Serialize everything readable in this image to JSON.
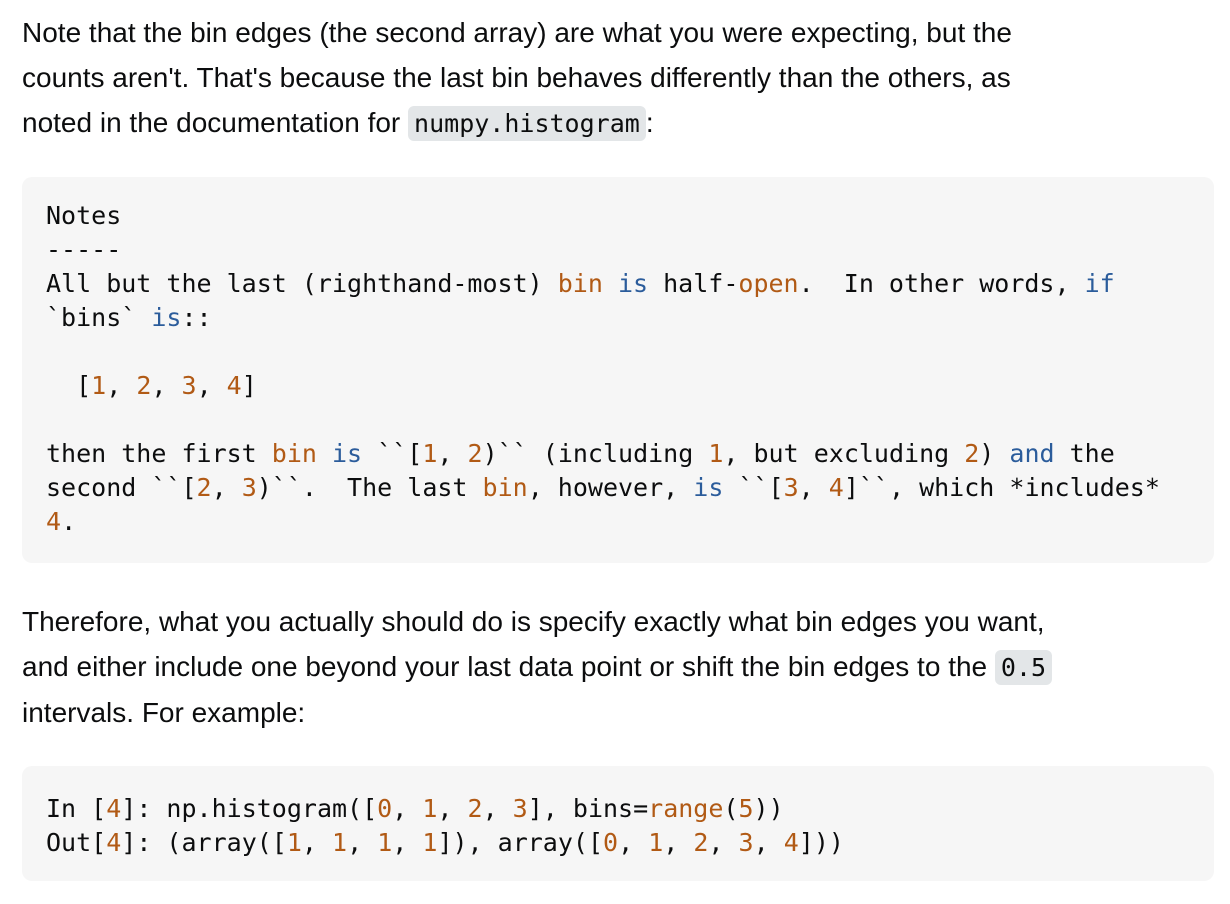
{
  "para1": {
    "line1": "Note that the bin edges (the second array) are what you were expecting, but the",
    "line2": "counts aren't. That's because the last bin behaves differently than the others, as",
    "line3_prefix": "noted in the documentation for ",
    "line3_code": "numpy.histogram",
    "line3_suffix": ":"
  },
  "notes_block": {
    "l1": "Notes",
    "l2": "-----",
    "l3": {
      "a": "All but the last (righthand-most) ",
      "b": "bin",
      "c": " ",
      "d": "is",
      "e": " half-",
      "f": "open",
      "g": ".  In other words, ",
      "h": "if"
    },
    "l4": {
      "a": "`bins` ",
      "b": "is",
      "c": "::"
    },
    "l5": "",
    "l6": {
      "a": "  [",
      "n1": "1",
      "s1": ", ",
      "n2": "2",
      "s2": ", ",
      "n3": "3",
      "s3": ", ",
      "n4": "4",
      "e": "]"
    },
    "l7": "",
    "l8": {
      "a": "then the first ",
      "b": "bin",
      "c": " ",
      "d": "is",
      "e": " ``[",
      "n1": "1",
      "s1": ", ",
      "n2": "2",
      "f": ")`` (including ",
      "n3": "1",
      "g": ", but excluding ",
      "n4": "2",
      "h": ") ",
      "i": "and",
      "j": " the"
    },
    "l9": {
      "a": "second ``[",
      "n1": "2",
      "s1": ", ",
      "n2": "3",
      "b": ")``.  The last ",
      "c": "bin",
      "d": ", however, ",
      "e": "is",
      "f": " ``[",
      "n3": "3",
      "s2": ", ",
      "n4": "4",
      "g": "]``, which *includes*"
    },
    "l10": {
      "n1": "4",
      "a": "."
    }
  },
  "para2": {
    "line1": "Therefore, what you actually should do is specify exactly what bin edges you want,",
    "line2_prefix": "and either include one beyond your last data point or shift the bin edges to the ",
    "line2_code": "0.5",
    "line3": "intervals. For example:"
  },
  "example_block": {
    "l1": {
      "a": "In [",
      "n1": "4",
      "b": "]: np.histogram([",
      "n2": "0",
      "s1": ", ",
      "n3": "1",
      "s2": ", ",
      "n4": "2",
      "s3": ", ",
      "n5": "3",
      "c": "], bins=",
      "d": "range",
      "e": "(",
      "n6": "5",
      "f": "))"
    },
    "l2": {
      "a": "Out[",
      "n1": "4",
      "b": "]: (array([",
      "n2": "1",
      "s1": ", ",
      "n3": "1",
      "s2": ", ",
      "n4": "1",
      "s3": ", ",
      "n5": "1",
      "c": "]), array([",
      "n6": "0",
      "s4": ", ",
      "n7": "1",
      "s5": ", ",
      "n8": "2",
      "s6": ", ",
      "n9": "3",
      "s7": ", ",
      "n10": "4",
      "d": "]))"
    }
  },
  "colors": {
    "keyword": "#2b5c9b",
    "literal": "#b15a15",
    "code_bg": "#f6f6f6",
    "inline_code_bg": "#e3e6e8"
  }
}
